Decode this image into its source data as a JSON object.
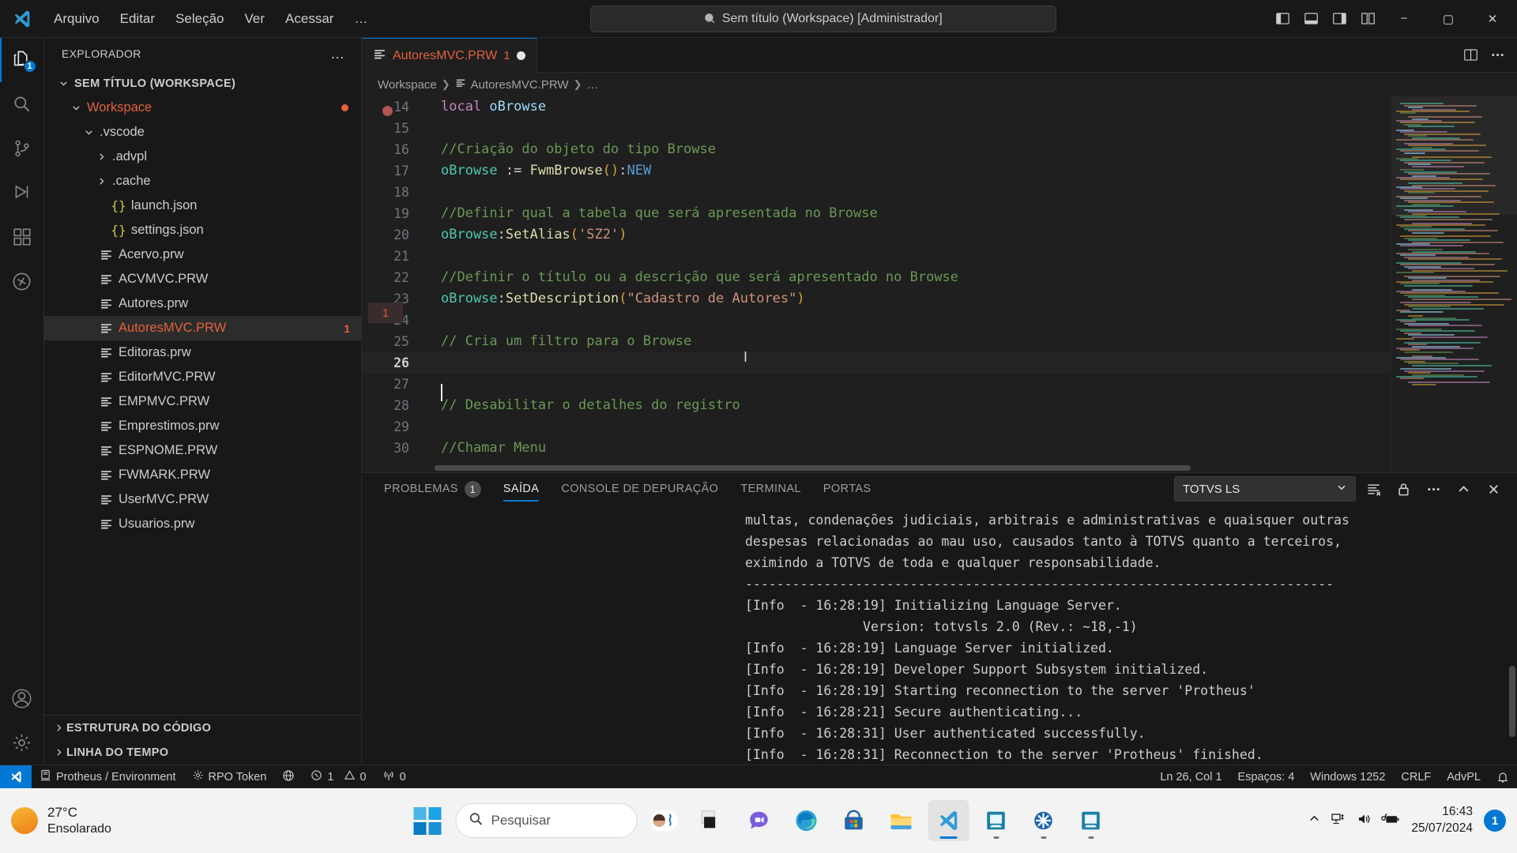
{
  "titlebar": {
    "menus": [
      "Arquivo",
      "Editar",
      "Seleção",
      "Ver",
      "Acessar",
      "…"
    ],
    "quick_input": "Sem título (Workspace) [Administrador]",
    "search_icon": "search-icon",
    "layout_buttons": [
      "toggle-primary-sidebar-icon",
      "toggle-panel-icon",
      "toggle-secondary-sidebar-icon",
      "customize-layout-icon"
    ],
    "window_controls": {
      "minimize": "−",
      "maximize": "▢",
      "close": "✕"
    }
  },
  "activitybar": {
    "items": [
      {
        "name": "explorer",
        "icon": "files-icon",
        "badge": "1",
        "active": true
      },
      {
        "name": "search",
        "icon": "search-icon",
        "badge": "",
        "active": false
      },
      {
        "name": "source-control",
        "icon": "source-control-icon",
        "badge": "",
        "active": false
      },
      {
        "name": "run-and-debug",
        "icon": "debug-icon",
        "badge": "",
        "active": false
      },
      {
        "name": "extensions",
        "icon": "extensions-icon",
        "badge": "",
        "active": false
      },
      {
        "name": "totvs",
        "icon": "totvs-icon",
        "badge": "",
        "active": false
      }
    ],
    "bottom": [
      {
        "name": "accounts",
        "icon": "account-icon"
      },
      {
        "name": "manage",
        "icon": "gear-icon"
      }
    ]
  },
  "sidebar": {
    "title": "EXPLORADOR",
    "more_actions": "…",
    "tree": [
      {
        "label": "SEM TÍTULO (WORKSPACE)",
        "indent": 0,
        "twist": "down",
        "kind": "root"
      },
      {
        "label": "Workspace",
        "indent": 1,
        "twist": "down",
        "kind": "folder",
        "color": "orange",
        "dirty": true
      },
      {
        "label": ".vscode",
        "indent": 2,
        "twist": "down",
        "kind": "folder"
      },
      {
        "label": ".advpl",
        "indent": 3,
        "twist": "right",
        "kind": "folder"
      },
      {
        "label": ".cache",
        "indent": 3,
        "twist": "right",
        "kind": "folder"
      },
      {
        "label": "launch.json",
        "indent": 3,
        "twist": "none",
        "kind": "json"
      },
      {
        "label": "settings.json",
        "indent": 3,
        "twist": "none",
        "kind": "json"
      },
      {
        "label": "Acervo.prw",
        "indent": 2,
        "twist": "none",
        "kind": "advpl"
      },
      {
        "label": "ACVMVC.PRW",
        "indent": 2,
        "twist": "none",
        "kind": "advpl"
      },
      {
        "label": "Autores.prw",
        "indent": 2,
        "twist": "none",
        "kind": "advpl"
      },
      {
        "label": "AutoresMVC.PRW",
        "indent": 2,
        "twist": "none",
        "kind": "advpl",
        "color": "orange",
        "selected": true,
        "badge": "1"
      },
      {
        "label": "Editoras.prw",
        "indent": 2,
        "twist": "none",
        "kind": "advpl"
      },
      {
        "label": "EditorMVC.PRW",
        "indent": 2,
        "twist": "none",
        "kind": "advpl"
      },
      {
        "label": "EMPMVC.PRW",
        "indent": 2,
        "twist": "none",
        "kind": "advpl"
      },
      {
        "label": "Emprestimos.prw",
        "indent": 2,
        "twist": "none",
        "kind": "advpl"
      },
      {
        "label": "ESPNOME.PRW",
        "indent": 2,
        "twist": "none",
        "kind": "advpl"
      },
      {
        "label": "FWMARK.PRW",
        "indent": 2,
        "twist": "none",
        "kind": "advpl"
      },
      {
        "label": "UserMVC.PRW",
        "indent": 2,
        "twist": "none",
        "kind": "advpl"
      },
      {
        "label": "Usuarios.prw",
        "indent": 2,
        "twist": "none",
        "kind": "advpl"
      }
    ],
    "sections": [
      "ESTRUTURA DO CÓDIGO",
      "LINHA DO TEMPO"
    ]
  },
  "editor": {
    "tab": {
      "label": "AutoresMVC.PRW",
      "problem_count": "1",
      "dirty": true,
      "icon": "advpl-file-icon"
    },
    "tab_actions": [
      "split-editor-icon",
      "more-actions-icon"
    ],
    "breadcrumb": [
      "Workspace",
      "AutoresMVC.PRW",
      "…"
    ],
    "cursor_line": 26,
    "gutter_badge": "1",
    "lines": [
      {
        "n": 14,
        "tokens": [
          {
            "t": "local ",
            "c": "kw"
          },
          {
            "t": "oBrowse",
            "c": "var"
          }
        ]
      },
      {
        "n": 15,
        "tokens": []
      },
      {
        "n": 16,
        "tokens": [
          {
            "t": "//Criação do objeto do tipo Browse",
            "c": "cmt"
          }
        ]
      },
      {
        "n": 17,
        "tokens": [
          {
            "t": "oBrowse",
            "c": "fn"
          },
          {
            "t": " := ",
            "c": "plain"
          },
          {
            "t": "FwmBrowse",
            "c": "meth"
          },
          {
            "t": "()",
            "c": "paren"
          },
          {
            "t": ":",
            "c": "plain"
          },
          {
            "t": "NEW",
            "c": "new"
          }
        ]
      },
      {
        "n": 18,
        "tokens": []
      },
      {
        "n": 19,
        "tokens": [
          {
            "t": "//Definir qual a tabela que será apresentada no Browse",
            "c": "cmt"
          }
        ]
      },
      {
        "n": 20,
        "tokens": [
          {
            "t": "oBrowse",
            "c": "fn"
          },
          {
            "t": ":",
            "c": "plain"
          },
          {
            "t": "SetAlias",
            "c": "meth"
          },
          {
            "t": "(",
            "c": "paren"
          },
          {
            "t": "'SZ2'",
            "c": "str"
          },
          {
            "t": ")",
            "c": "paren"
          }
        ]
      },
      {
        "n": 21,
        "tokens": []
      },
      {
        "n": 22,
        "tokens": [
          {
            "t": "//Definir o título ou a descrição que será apresentado no Browse",
            "c": "cmt"
          }
        ]
      },
      {
        "n": 23,
        "tokens": [
          {
            "t": "oBrowse",
            "c": "fn"
          },
          {
            "t": ":",
            "c": "plain"
          },
          {
            "t": "SetDescription",
            "c": "meth"
          },
          {
            "t": "(",
            "c": "paren"
          },
          {
            "t": "\"Cadastro de Autores\"",
            "c": "str"
          },
          {
            "t": ")",
            "c": "paren"
          }
        ]
      },
      {
        "n": 24,
        "tokens": []
      },
      {
        "n": 25,
        "tokens": [
          {
            "t": "// Cria um filtro para o Browse",
            "c": "cmt"
          }
        ]
      },
      {
        "n": 26,
        "tokens": []
      },
      {
        "n": 27,
        "tokens": []
      },
      {
        "n": 28,
        "tokens": [
          {
            "t": "// Desabilitar o detalhes do registro",
            "c": "cmt"
          }
        ]
      },
      {
        "n": 29,
        "tokens": []
      },
      {
        "n": 30,
        "tokens": [
          {
            "t": "//Chamar Menu",
            "c": "cmt"
          }
        ]
      }
    ]
  },
  "panel": {
    "tabs": [
      {
        "label": "PROBLEMAS",
        "badge": "1",
        "active": false
      },
      {
        "label": "SAÍDA",
        "badge": "",
        "active": true
      },
      {
        "label": "CONSOLE DE DEPURAÇÃO",
        "badge": "",
        "active": false
      },
      {
        "label": "TERMINAL",
        "badge": "",
        "active": false
      },
      {
        "label": "PORTAS",
        "badge": "",
        "active": false
      }
    ],
    "channel": "TOTVS LS",
    "actions": [
      "clear-output-icon",
      "lock-icon",
      "more-actions-icon",
      "maximize-panel-icon",
      "close-panel-icon"
    ],
    "output": [
      "multas, condenações judiciais, arbitrais e administrativas e quaisquer outras",
      "despesas relacionadas ao mau uso, causados tanto à TOTVS quanto a terceiros,",
      "eximindo a TOTVS de toda e qualquer responsabilidade.",
      "---------------------------------------------------------------------------",
      "[Info  - 16:28:19] Initializing Language Server.",
      "               Version: totvsls 2.0 (Rev.: ~18,-1)",
      "[Info  - 16:28:19] Language Server initialized.",
      "[Info  - 16:28:19] Developer Support Subsystem initialized.",
      "[Info  - 16:28:19] Starting reconnection to the server 'Protheus'",
      "[Info  - 16:28:21] Secure authenticating...",
      "[Info  - 16:28:31] User authenticated successfully.",
      "[Info  - 16:28:31] Reconnection to the server 'Protheus' finished."
    ]
  },
  "statusbar": {
    "remote_icon": "remote-window-icon",
    "left": [
      {
        "label": "Protheus / Environment",
        "icon": "server-icon"
      },
      {
        "label": "RPO Token",
        "icon": "gear-icon"
      },
      {
        "label": "",
        "icon": "globe-icon"
      },
      {
        "label": "1",
        "icon": "error-icon",
        "label2": "0",
        "icon2": "warning-icon"
      },
      {
        "label": "0",
        "icon": "radio-tower-icon"
      }
    ],
    "right": [
      {
        "label": "Ln 26, Col 1"
      },
      {
        "label": "Espaços: 4"
      },
      {
        "label": "Windows 1252"
      },
      {
        "label": "CRLF"
      },
      {
        "label": "AdvPL"
      },
      {
        "label": "",
        "icon": "bell-dot-icon"
      }
    ]
  },
  "taskbar": {
    "weather": {
      "temp": "27°C",
      "condition": "Ensolarado",
      "icon": "sun-icon"
    },
    "start_icon": "windows-start-icon",
    "search_placeholder": "Pesquisar",
    "apps": [
      {
        "name": "copilot-avatar",
        "running": false
      },
      {
        "name": "task-view",
        "running": false
      },
      {
        "name": "chat-app",
        "running": false
      },
      {
        "name": "microsoft-edge",
        "running": true
      },
      {
        "name": "microsoft-store",
        "running": true
      },
      {
        "name": "file-explorer",
        "running": true
      },
      {
        "name": "visual-studio-code",
        "running": true,
        "active": true
      },
      {
        "name": "remote-desktop",
        "running": true
      },
      {
        "name": "totvs-app",
        "running": true
      },
      {
        "name": "remote-desktop-2",
        "running": true
      }
    ],
    "tray": [
      "chevron-up-icon",
      "network-icon",
      "volume-icon",
      "battery-charging-icon"
    ],
    "clock": {
      "time": "16:43",
      "date": "25/07/2024"
    },
    "notification_count": "1"
  }
}
